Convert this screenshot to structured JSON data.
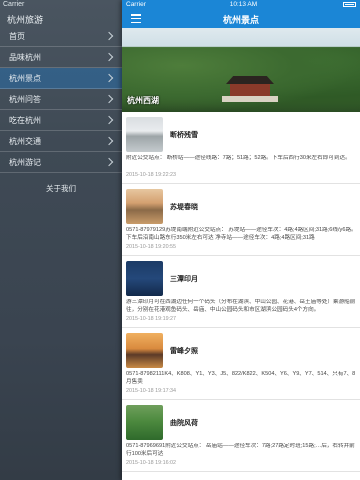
{
  "sidebar": {
    "status_carrier": "Carrier",
    "title": "杭州旅游",
    "items": [
      {
        "label": "首页"
      },
      {
        "label": "品味杭州"
      },
      {
        "label": "杭州景点"
      },
      {
        "label": "杭州问答"
      },
      {
        "label": "吃在杭州"
      },
      {
        "label": "杭州交通"
      },
      {
        "label": "杭州游记"
      }
    ],
    "active_index": 2,
    "about": "关于我们"
  },
  "main": {
    "status": {
      "carrier": "Carrier",
      "time": "10:13 AM"
    },
    "title": "杭州景点",
    "hero_label": "杭州西湖",
    "list": [
      {
        "name": "断桥残雪",
        "desc": "附近公交站点：  断桥站——途径线路：7路；51路；52路。下车后西行30米左右即可到达。",
        "date": "2015-10-18 19:22:23"
      },
      {
        "name": "苏堤春晓",
        "desc": "0571-87979129苏堤南端附近公交站点：  苏堤站——途径车次：4路;4路区间;31路;6线/y6路。下车后沿南山路东行350米左右可达 净寺站——途径车次：4路;4路区间;31路",
        "date": "2015-10-18 19:20:55"
      },
      {
        "name": "三潭印月",
        "desc": "游三潭印月可在西湖边任何一个码头（分布在湖滨、中山公园、花港、岳王庙等处）乘游船前往，分别在花港观鱼码头、岳庙、中山公园码头和市区湖滨公园码头4个方向。",
        "date": "2015-10-18 19:19:27"
      },
      {
        "name": "雷峰夕照",
        "desc": "0571-87982111K4、K808、Y1、Y3、J5、822/K822、K504、Y6、Y9、Y7、514、只有7、8月售卖",
        "date": "2015-10-18 19:17:34"
      },
      {
        "name": "曲院风荷",
        "desc": "0571-87969691附近公交站点：  岳庙站——途径车次：7路;27路定时班;15路;…后，右转并前行100米后可达",
        "date": "2015-10-18 19:16:02"
      }
    ]
  }
}
